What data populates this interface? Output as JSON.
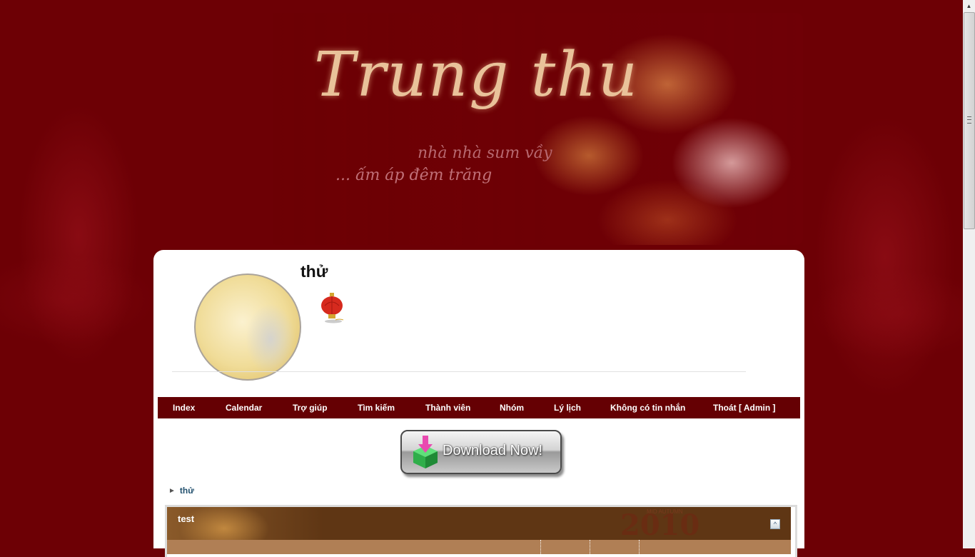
{
  "banner": {
    "title": "Trung thu",
    "subtitle_line1": "nhà nhà  sum  vầy",
    "subtitle_line2": "... ấm áp đêm trăng"
  },
  "header": {
    "site_title": "thử"
  },
  "nav": {
    "items": [
      {
        "label": "Index"
      },
      {
        "label": "Calendar"
      },
      {
        "label": "Trợ giúp"
      },
      {
        "label": "Tìm kiếm"
      },
      {
        "label": "Thành viên"
      },
      {
        "label": "Nhóm"
      },
      {
        "label": "Lý lịch"
      },
      {
        "label": "Không có tin nhắn"
      },
      {
        "label": "Thoát [ Admin ]"
      }
    ]
  },
  "download": {
    "label": "Download Now!"
  },
  "breadcrumb": {
    "arrow": "►",
    "link": "thử"
  },
  "forum": {
    "category_title": "test",
    "watermark": "2010",
    "watermark_sub": "MID AUTUMN",
    "collapse_icon": "^"
  },
  "colors": {
    "background": "#6d0005",
    "navbar": "#650003",
    "forum_header": "#5f3614",
    "forum_column_header": "#b07f55",
    "link": "#22506e"
  }
}
